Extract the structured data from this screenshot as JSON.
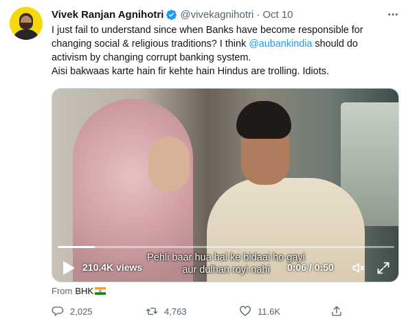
{
  "author": {
    "name": "Vivek Ranjan Agnihotri",
    "handle": "@vivekagnihotri",
    "separator": "·",
    "date": "Oct 10"
  },
  "tweet": {
    "line1": "I just fail to understand since when Banks have become responsible for",
    "line2": "changing social & religious traditions? I think ",
    "mention": "@aubankindia",
    "line2_tail": " should do",
    "line3": "activism by changing corrupt banking system.",
    "line4": "Aisi bakwaas karte hain fir kehte hain Hindus are trolling. Idiots."
  },
  "video": {
    "subtitle_line1": "Pehli baar hua hai ke bidaai ho gayi",
    "subtitle_line2": "aur dulhan royi nahi",
    "views": "210.4K views",
    "timecode": "0:06 / 0:50",
    "progress": 0.11
  },
  "source": {
    "label": "From",
    "app": "BHK"
  },
  "actions": {
    "replies": "2,025",
    "retweets": "4,763",
    "likes": "11.6K"
  },
  "colors": {
    "accent": "#1d9bf0",
    "muted": "#536471",
    "text": "#0f1419"
  },
  "icons": [
    "verified-badge-icon",
    "more-icon",
    "play-icon",
    "volume-icon",
    "fullscreen-icon",
    "india-flag-icon",
    "reply-icon",
    "retweet-icon",
    "like-icon",
    "share-icon"
  ]
}
